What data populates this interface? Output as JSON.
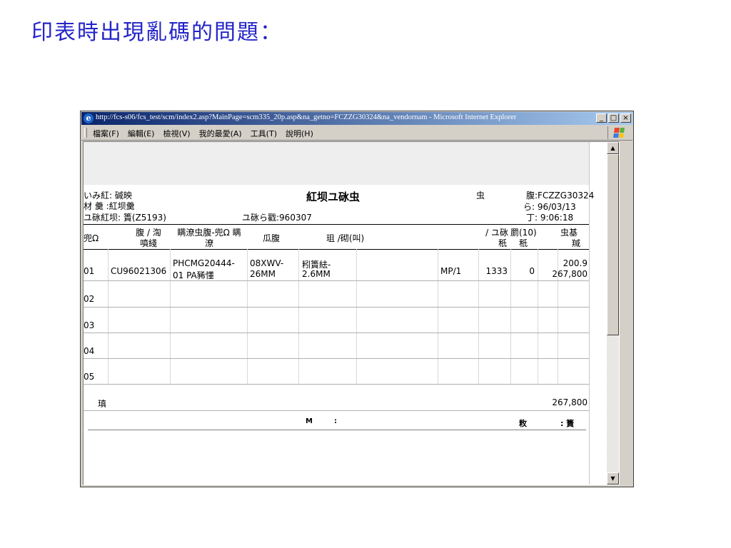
{
  "slide": {
    "title": "印表時出現亂碼的問題："
  },
  "window": {
    "title": "http://fcs-s06/fcs_test/scm/index2.asp?MainPage=scm335_20p.asp&na_getno=FCZZG30324&na_vendornam - Microsoft Internet Explorer",
    "menu": [
      "檔案(F)",
      "編輯(E)",
      "檢視(V)",
      "我的最愛(A)",
      "工具(T)",
      "說明(H)"
    ],
    "buttons": {
      "minimize": "_",
      "maximize": "□",
      "close": "×"
    }
  },
  "document": {
    "title": "紅坝ユ砯虫",
    "left_info": [
      "いみ紅: 碱映",
      "材  羹 :紅坝羹",
      "ユ砯紅坝:   簣(Z5193)"
    ],
    "mid_info": "ユ砯ら戳:960307",
    "right_info": {
      "label_a": "虫",
      "line1": "腹:FCZZG30324",
      "line2": "ら: 96/03/13",
      "line3": "丁: 9:06:18"
    },
    "headers": {
      "no": "兜Ω",
      "order_1": "腹 / 渹",
      "order_2": "噴綫",
      "part_1": "瞒潦虫腹-兜Ω 瞒",
      "part_2": "潦",
      "spec": "瓜腹",
      "desc": "珇    /砌(叫)",
      "unit_1": "/ ユ砯",
      "unit_2": "秖",
      "qty_1": "罽(10)",
      "qty_2": "秖",
      "price_1": "虫基",
      "price_2": "羬"
    },
    "rows": [
      {
        "no": "01",
        "order": "CU96021306",
        "part_1": "PHCMG20444-",
        "part_2": "01 PA豨懂",
        "spec_1": "08XWV-",
        "spec_2": "26MM",
        "desc_1": "粌簣紶-",
        "desc_2": "2.6MM",
        "unit": "MP/1",
        "qty": "1333",
        "qty2": "0",
        "price_1": "200.9",
        "price_2": "267,800"
      },
      {
        "no": "02"
      },
      {
        "no": "03"
      },
      {
        "no": "04"
      },
      {
        "no": "05"
      }
    ],
    "total_label": "瑱",
    "total_value": "267,800",
    "footer": {
      "m_label": "M",
      "colon": ":",
      "right_label": "敉",
      "right_value": ":  簣"
    }
  }
}
